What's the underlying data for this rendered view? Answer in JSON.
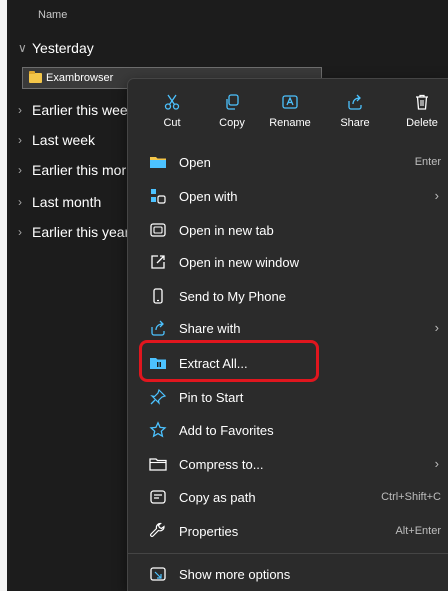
{
  "explorer": {
    "column_header": "Name",
    "groups": [
      {
        "label": "Yesterday",
        "expanded": true
      },
      {
        "label": "Earlier this wee",
        "expanded": false
      },
      {
        "label": "Last week",
        "expanded": false
      },
      {
        "label": "Earlier this mor",
        "expanded": false
      },
      {
        "label": "Last month",
        "expanded": false
      },
      {
        "label": "Earlier this year",
        "expanded": false
      }
    ],
    "selected_file": "Exambrowser"
  },
  "context_menu": {
    "quick_actions": [
      {
        "label": "Cut",
        "icon": "scissors-icon"
      },
      {
        "label": "Copy",
        "icon": "copy-icon"
      },
      {
        "label": "Rename",
        "icon": "rename-icon"
      },
      {
        "label": "Share",
        "icon": "share-icon"
      },
      {
        "label": "Delete",
        "icon": "trash-icon"
      }
    ],
    "items": [
      {
        "label": "Open",
        "shortcut": "Enter",
        "icon": "folder-open-icon"
      },
      {
        "label": "Open with",
        "submenu": true,
        "icon": "open-with-icon"
      },
      {
        "label": "Open in new tab",
        "icon": "new-tab-icon"
      },
      {
        "label": "Open in new window",
        "icon": "new-window-icon"
      },
      {
        "label": "Send to My Phone",
        "icon": "phone-icon"
      },
      {
        "label": "Share with",
        "submenu": true,
        "icon": "share-icon"
      },
      {
        "label": "Extract All...",
        "icon": "extract-icon",
        "highlighted": true
      },
      {
        "label": "Pin to Start",
        "icon": "pin-icon"
      },
      {
        "label": "Add to Favorites",
        "icon": "star-icon"
      },
      {
        "label": "Compress to...",
        "submenu": true,
        "icon": "compress-icon"
      },
      {
        "label": "Copy as path",
        "shortcut": "Ctrl+Shift+C",
        "icon": "copy-path-icon"
      },
      {
        "label": "Properties",
        "shortcut": "Alt+Enter",
        "icon": "wrench-icon"
      }
    ],
    "more_options": {
      "label": "Show more options",
      "icon": "more-options-icon"
    }
  },
  "colors": {
    "background": "#1c1c1c",
    "menu_background": "#2b2b2b",
    "accent": "#4cc2ff",
    "highlight_border": "#e0161e",
    "folder": "#f4c649"
  }
}
